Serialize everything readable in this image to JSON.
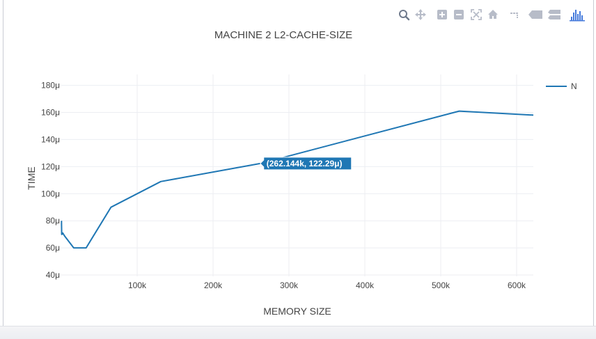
{
  "modebar": {
    "buttons": [
      "zoom-icon",
      "pan-icon",
      "zoom-in-icon",
      "zoom-out-icon",
      "autoscale-icon",
      "reset-axes-icon",
      "spike-lines-icon",
      "hover-closest-icon",
      "hover-compare-icon",
      "plotly-logo-icon"
    ],
    "accent": "#447adb",
    "icon_color": "#b7bcc8"
  },
  "chart_data": {
    "type": "line",
    "title": "MACHINE 2 L2-CACHE-SIZE",
    "xlabel": "MEMORY SIZE",
    "ylabel": "TIME",
    "xlim": [
      0,
      622000
    ],
    "ylim": [
      39,
      188
    ],
    "x_ticks": [
      100000,
      200000,
      300000,
      400000,
      500000,
      600000
    ],
    "x_tick_labels": [
      "100k",
      "200k",
      "300k",
      "400k",
      "500k",
      "600k"
    ],
    "y_ticks": [
      40,
      60,
      80,
      100,
      120,
      140,
      160,
      180
    ],
    "y_tick_labels": [
      "40μ",
      "60μ",
      "80μ",
      "100μ",
      "120μ",
      "140μ",
      "160μ",
      "180μ"
    ],
    "grid": true,
    "legend_position": "top-right",
    "series": [
      {
        "name": "N",
        "color": "#1f77b4",
        "x": [
          256,
          512,
          1024,
          2048,
          4096,
          8192,
          16384,
          32768,
          65536,
          131072,
          262144,
          524288,
          622000
        ],
        "y": [
          80,
          70,
          70,
          71,
          69,
          66,
          60,
          60,
          90,
          109,
          122.29,
          161,
          158
        ]
      }
    ],
    "hover": {
      "label": "(262.144k, 122.29μ)",
      "x": 262144,
      "y": 122.29
    }
  }
}
